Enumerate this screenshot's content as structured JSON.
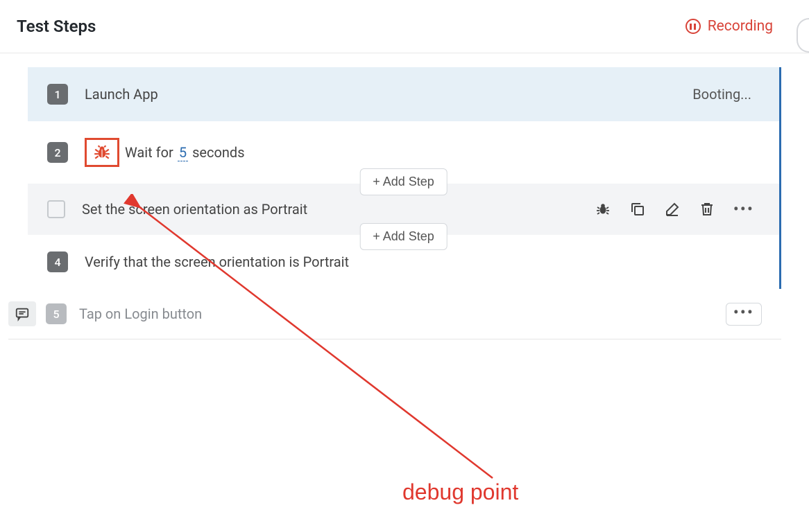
{
  "header": {
    "title": "Test Steps",
    "recording_label": "Recording"
  },
  "steps": {
    "step1": {
      "num": "1",
      "label": "Launch App",
      "status": "Booting..."
    },
    "step2": {
      "num": "2",
      "wait_prefix": "Wait for",
      "wait_value": "5",
      "wait_suffix": "seconds"
    },
    "step3": {
      "label": "Set the screen orientation as Portrait"
    },
    "step4": {
      "num": "4",
      "label": "Verify that the screen orientation is Portrait"
    },
    "step5": {
      "num": "5",
      "label": "Tap on Login button"
    }
  },
  "buttons": {
    "add_step": "+ Add Step"
  },
  "annotation": {
    "label": "debug point"
  }
}
